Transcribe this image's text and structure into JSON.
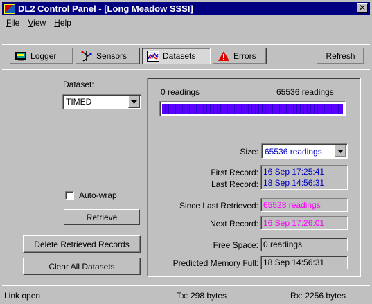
{
  "window": {
    "title": "DL2 Control Panel - [Long Meadow SSSI]",
    "close_glyph": "✕"
  },
  "menu": {
    "items": [
      "File",
      "View",
      "Help"
    ]
  },
  "toolbar": {
    "logger_label": "Logger",
    "sensors_label": "Sensors",
    "datasets_label": "Datasets",
    "errors_label": "Errors",
    "refresh_label": "Refresh",
    "active_tab": "Datasets"
  },
  "left": {
    "dataset_label": "Dataset:",
    "dataset_value": "TIMED",
    "autowrap_label": "Auto-wrap",
    "autowrap_checked": false,
    "retrieve_label": "Retrieve",
    "delete_label": "Delete Retrieved Records",
    "clear_label": "Clear All Datasets"
  },
  "panel": {
    "min_label": "0 readings",
    "max_label": "65536 readings",
    "fill_fraction": 1.0,
    "size_label": "Size:",
    "size_value": "65536 readings",
    "first_label": "First Record:",
    "first_value": "16 Sep 17:25:41",
    "last_label": "Last Record:",
    "last_value": "18 Sep 14:56:31",
    "since_label": "Since Last Retrieved:",
    "since_value": "65528 readings",
    "next_label": "Next Record:",
    "next_value": "16 Sep 17:26:01",
    "free_label": "Free Space:",
    "free_value": "0 readings",
    "pmf_label": "Predicted Memory Full:",
    "pmf_value": "18 Sep 14:56:31"
  },
  "status": {
    "link": "Link open",
    "tx": "Tx: 298 bytes",
    "rx": "Rx: 2256 bytes"
  },
  "colors": {
    "blue_text": "#0000c0",
    "magenta_text": "#ff00ff",
    "bar_fill": "#4a00ff",
    "title_bg": "#000080"
  }
}
